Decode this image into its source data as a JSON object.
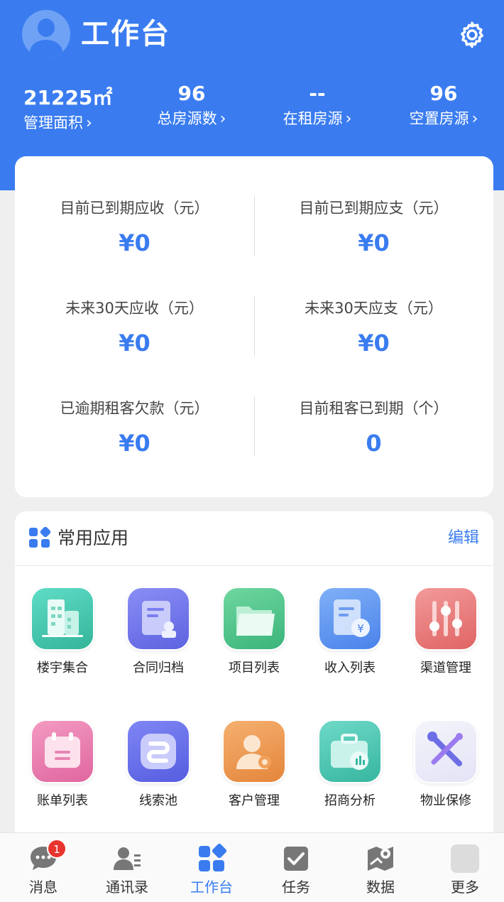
{
  "header": {
    "title": "工作台",
    "avatar_icon": "user-avatar-icon",
    "settings_icon": "gear-icon"
  },
  "stats": [
    {
      "value": "21225",
      "unit": "㎡",
      "label": "管理面积"
    },
    {
      "value": "96",
      "label": "总房源数"
    },
    {
      "value": "--",
      "label": "在租房源"
    },
    {
      "value": "96",
      "label": "空置房源"
    }
  ],
  "finance": [
    {
      "label": "目前已到期应收（元）",
      "value": "¥0"
    },
    {
      "label": "目前已到期应支（元）",
      "value": "¥0"
    },
    {
      "label": "未来30天应收（元）",
      "value": "¥0"
    },
    {
      "label": "未来30天应支（元）",
      "value": "¥0"
    },
    {
      "label": "已逾期租客欠款（元）",
      "value": "¥0"
    },
    {
      "label": "目前租客已到期（个）",
      "value": "0"
    }
  ],
  "apps": {
    "title": "常用应用",
    "edit_label": "编辑",
    "items": [
      {
        "label": "楼宇集合",
        "icon": "building-icon"
      },
      {
        "label": "合同归档",
        "icon": "contract-icon"
      },
      {
        "label": "项目列表",
        "icon": "folder-icon"
      },
      {
        "label": "收入列表",
        "icon": "income-icon"
      },
      {
        "label": "渠道管理",
        "icon": "sliders-icon"
      },
      {
        "label": "账单列表",
        "icon": "calendar-bill-icon"
      },
      {
        "label": "线索池",
        "icon": "leads-icon"
      },
      {
        "label": "客户管理",
        "icon": "customer-icon"
      },
      {
        "label": "招商分析",
        "icon": "briefcase-chart-icon"
      },
      {
        "label": "物业保修",
        "icon": "tools-icon"
      }
    ]
  },
  "tabbar": {
    "items": [
      {
        "label": "消息",
        "icon": "chat-icon",
        "badge": "1"
      },
      {
        "label": "通讯录",
        "icon": "contacts-icon"
      },
      {
        "label": "工作台",
        "icon": "workbench-icon",
        "active": true
      },
      {
        "label": "任务",
        "icon": "task-icon"
      },
      {
        "label": "数据",
        "icon": "map-data-icon"
      },
      {
        "label": "更多",
        "icon": "more-icon"
      }
    ]
  },
  "colors": {
    "primary": "#3a7cf0",
    "badge": "#e8342e"
  }
}
